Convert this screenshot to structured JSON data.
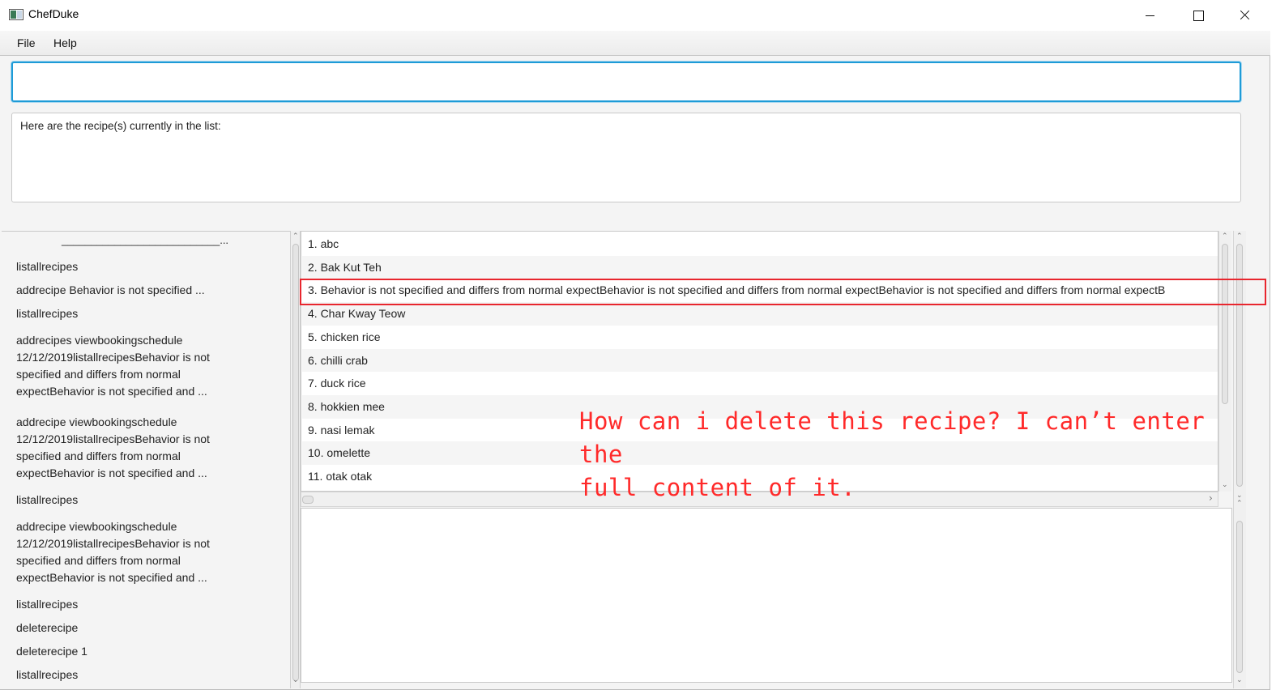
{
  "window": {
    "title": "ChefDuke"
  },
  "menu": {
    "file": "File",
    "help": "Help"
  },
  "command_input": {
    "value": "",
    "placeholder": ""
  },
  "response": {
    "text": "Here are the recipe(s) currently in the list:"
  },
  "history": {
    "top_truncated": "___________________________...",
    "items": [
      "listallrecipes",
      "addrecipe Behavior is not specified ...",
      "listallrecipes",
      "addrecipes viewbookingschedule 12/12/2019listallrecipesBehavior is not specified and differs from normal expectBehavior is not specified and ...",
      "addrecipe viewbookingschedule 12/12/2019listallrecipesBehavior is not specified and differs from normal expectBehavior is not specified and ...",
      "listallrecipes",
      "addrecipe viewbookingschedule 12/12/2019listallrecipesBehavior is not specified and differs from normal expectBehavior is not specified and ...",
      "listallrecipes",
      "deleterecipe",
      "deleterecipe 1",
      "listallrecipes"
    ]
  },
  "recipes": [
    "1. abc",
    "2. Bak Kut Teh",
    "3. Behavior is not specified and differs from normal expectBehavior is not specified and differs from normal expectBehavior is not specified and differs from normal expectB",
    "4. Char Kway Teow",
    "5. chicken rice",
    "6. chilli crab",
    "7. duck rice",
    "8. hokkien mee",
    "9. nasi lemak",
    "10. omelette",
    "11. otak otak"
  ],
  "annotation": {
    "line1": "How can i delete this recipe? I can’t enter the",
    "line2": "full content of it.",
    "color": "#ff2a2a"
  },
  "colors": {
    "focus_border": "#1e9bd7",
    "highlight": "#e8262e"
  }
}
